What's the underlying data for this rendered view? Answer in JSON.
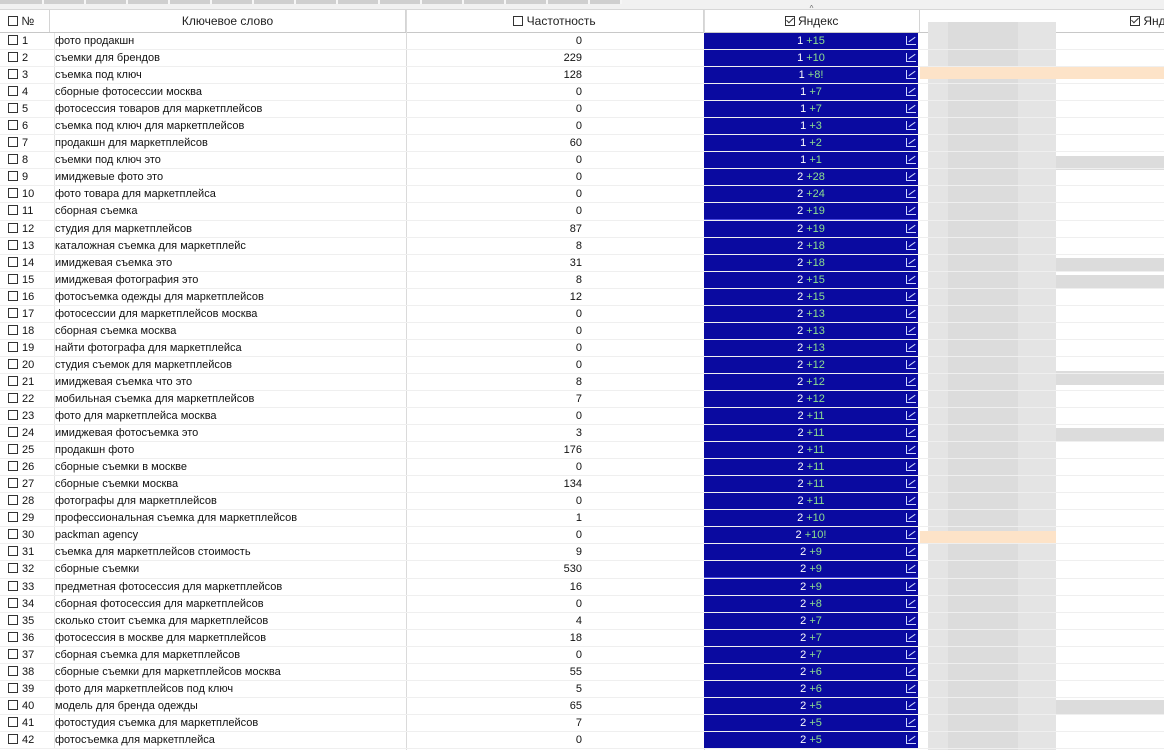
{
  "header": {
    "num_label": "№",
    "keyword_label": "Ключевое слово",
    "freq_label": "Частотность",
    "yandex_label": "Яндекс",
    "yandex2_label": "Янд"
  },
  "rows": [
    {
      "n": "1",
      "kw": "фото продакшн",
      "freq": "0",
      "pos": "1",
      "delta": "+15"
    },
    {
      "n": "2",
      "kw": "съемки для брендов",
      "freq": "229",
      "pos": "1",
      "delta": "+10"
    },
    {
      "n": "3",
      "kw": "съемка под ключ",
      "freq": "128",
      "pos": "1",
      "delta": "+8!"
    },
    {
      "n": "4",
      "kw": "сборные фотосессии москва",
      "freq": "0",
      "pos": "1",
      "delta": "+7"
    },
    {
      "n": "5",
      "kw": "фотосессия товаров для маркетплейсов",
      "freq": "0",
      "pos": "1",
      "delta": "+7"
    },
    {
      "n": "6",
      "kw": "съемка под ключ для маркетплейсов",
      "freq": "0",
      "pos": "1",
      "delta": "+3"
    },
    {
      "n": "7",
      "kw": "продакшн для маркетплейсов",
      "freq": "60",
      "pos": "1",
      "delta": "+2"
    },
    {
      "n": "8",
      "kw": "съемки под ключ это",
      "freq": "0",
      "pos": "1",
      "delta": "+1"
    },
    {
      "n": "9",
      "kw": "имиджевые фото это",
      "freq": "0",
      "pos": "2",
      "delta": "+28"
    },
    {
      "n": "10",
      "kw": "фото товара для маркетплейса",
      "freq": "0",
      "pos": "2",
      "delta": "+24"
    },
    {
      "n": "11",
      "kw": "сборная съемка",
      "freq": "0",
      "pos": "2",
      "delta": "+19"
    },
    {
      "n": "12",
      "kw": "студия для маркетплейсов",
      "freq": "87",
      "pos": "2",
      "delta": "+19"
    },
    {
      "n": "13",
      "kw": "каталожная съемка для маркетплейс",
      "freq": "8",
      "pos": "2",
      "delta": "+18"
    },
    {
      "n": "14",
      "kw": "имиджевая съемка это",
      "freq": "31",
      "pos": "2",
      "delta": "+18"
    },
    {
      "n": "15",
      "kw": "имиджевая фотография это",
      "freq": "8",
      "pos": "2",
      "delta": "+15"
    },
    {
      "n": "16",
      "kw": "фотосъемка одежды для маркетплейсов",
      "freq": "12",
      "pos": "2",
      "delta": "+15"
    },
    {
      "n": "17",
      "kw": "фотосессии для маркетплейсов москва",
      "freq": "0",
      "pos": "2",
      "delta": "+13"
    },
    {
      "n": "18",
      "kw": "сборная съемка москва",
      "freq": "0",
      "pos": "2",
      "delta": "+13"
    },
    {
      "n": "19",
      "kw": "найти фотографа для маркетплейса",
      "freq": "0",
      "pos": "2",
      "delta": "+13"
    },
    {
      "n": "20",
      "kw": "студия съемок для маркетплейсов",
      "freq": "0",
      "pos": "2",
      "delta": "+12"
    },
    {
      "n": "21",
      "kw": "имиджевая съемка что это",
      "freq": "8",
      "pos": "2",
      "delta": "+12"
    },
    {
      "n": "22",
      "kw": "мобильная съемка для маркетплейсов",
      "freq": "7",
      "pos": "2",
      "delta": "+12"
    },
    {
      "n": "23",
      "kw": "фото для маркетплейса москва",
      "freq": "0",
      "pos": "2",
      "delta": "+11"
    },
    {
      "n": "24",
      "kw": "имиджевая фотосъемка это",
      "freq": "3",
      "pos": "2",
      "delta": "+11"
    },
    {
      "n": "25",
      "kw": "продакшн фото",
      "freq": "176",
      "pos": "2",
      "delta": "+11"
    },
    {
      "n": "26",
      "kw": "сборные съемки в москве",
      "freq": "0",
      "pos": "2",
      "delta": "+11"
    },
    {
      "n": "27",
      "kw": "сборные съемки москва",
      "freq": "134",
      "pos": "2",
      "delta": "+11"
    },
    {
      "n": "28",
      "kw": "фотографы для маркетплейсов",
      "freq": "0",
      "pos": "2",
      "delta": "+11"
    },
    {
      "n": "29",
      "kw": "профессиональная съемка для маркетплейсов",
      "freq": "1",
      "pos": "2",
      "delta": "+10"
    },
    {
      "n": "30",
      "kw": "packman agency",
      "freq": "0",
      "pos": "2",
      "delta": "+10!"
    },
    {
      "n": "31",
      "kw": "съемка для маркетплейсов стоимость",
      "freq": "9",
      "pos": "2",
      "delta": "+9"
    },
    {
      "n": "32",
      "kw": "сборные съемки",
      "freq": "530",
      "pos": "2",
      "delta": "+9"
    },
    {
      "n": "33",
      "kw": "предметная фотосессия для маркетплейсов",
      "freq": "16",
      "pos": "2",
      "delta": "+9"
    },
    {
      "n": "34",
      "kw": "сборная фотосессия для маркетплейсов",
      "freq": "0",
      "pos": "2",
      "delta": "+8"
    },
    {
      "n": "35",
      "kw": "сколько стоит съемка для маркетплейсов",
      "freq": "4",
      "pos": "2",
      "delta": "+7"
    },
    {
      "n": "36",
      "kw": "фотосессия в москве для маркетплейсов",
      "freq": "18",
      "pos": "2",
      "delta": "+7"
    },
    {
      "n": "37",
      "kw": "сборная съемка для маркетплейсов",
      "freq": "0",
      "pos": "2",
      "delta": "+7"
    },
    {
      "n": "38",
      "kw": "сборные съемки для маркетплейсов москва",
      "freq": "55",
      "pos": "2",
      "delta": "+6"
    },
    {
      "n": "39",
      "kw": "фото для маркетплейсов под ключ",
      "freq": "5",
      "pos": "2",
      "delta": "+6"
    },
    {
      "n": "40",
      "kw": "модель для бренда одежды",
      "freq": "65",
      "pos": "2",
      "delta": "+5"
    },
    {
      "n": "41",
      "kw": "фотостудия съемка для маркетплейсов",
      "freq": "7",
      "pos": "2",
      "delta": "+5"
    },
    {
      "n": "42",
      "kw": "фотосъемка для маркетплейса",
      "freq": "0",
      "pos": "2",
      "delta": "+5"
    }
  ],
  "colors": {
    "yandex_cell": "#0a0aa0",
    "delta_text": "#8ee08e",
    "highlight": "#fde3c8"
  },
  "icons": {
    "row_chart": "line-chart-icon",
    "checkbox": "checkbox-icon"
  }
}
